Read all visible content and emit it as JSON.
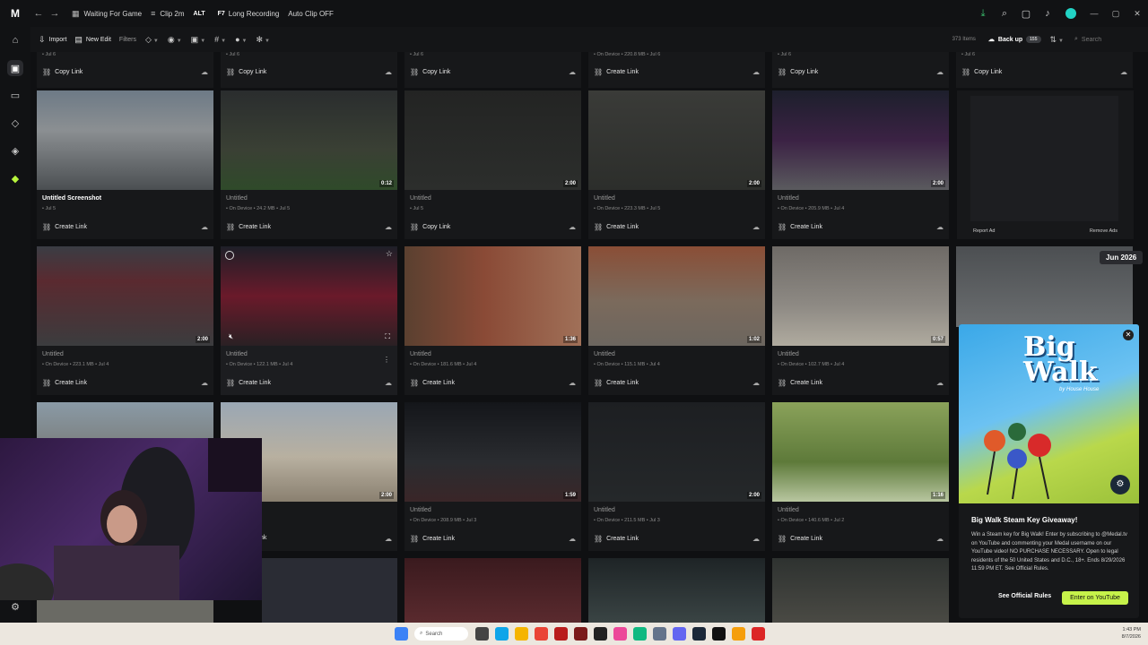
{
  "titlebar": {
    "tabs": [
      {
        "label": "Waiting For Game"
      },
      {
        "label": "Clip 2m"
      },
      {
        "key": "ALT",
        "label": ""
      },
      {
        "key": "F7",
        "label": "Long Recording"
      },
      {
        "label": "Auto Clip OFF"
      }
    ]
  },
  "toolbar": {
    "import": "Import",
    "new_edit": "New Edit",
    "filters": "Filters",
    "count": "373 Items",
    "backup": "Back up",
    "backup_badge": "155",
    "search_placeholder": "Search"
  },
  "top_row": [
    {
      "meta": "• Jul 6",
      "action": "Copy Link"
    },
    {
      "meta": "• Jul 6",
      "action": "Copy Link"
    },
    {
      "meta": "• Jul 6",
      "action": "Copy Link"
    },
    {
      "meta": "• On Device • 220.8 MB • Jul 6",
      "action": "Create Link"
    },
    {
      "meta": "• Jul 6",
      "action": "Copy Link"
    },
    {
      "meta": "• Jul 6",
      "action": "Copy Link"
    }
  ],
  "row1": [
    {
      "title": "Untitled Screenshot",
      "meta": "• Jul 5",
      "duration": "",
      "action": "Create Link",
      "bright": true
    },
    {
      "title": "Untitled",
      "meta": "• On Device • 24.2 MB • Jul 5",
      "duration": "0:12",
      "action": "Create Link"
    },
    {
      "title": "Untitled",
      "meta": "• Jul 5",
      "duration": "2:00",
      "action": "Copy Link"
    },
    {
      "title": "Untitled",
      "meta": "• On Device • 223.3 MB • Jul 5",
      "duration": "2:00",
      "action": "Create Link"
    },
    {
      "title": "Untitled",
      "meta": "• On Device • 205.9 MB • Jul 4",
      "duration": "2:00",
      "action": "Create Link"
    }
  ],
  "row2": [
    {
      "title": "Untitled",
      "meta": "• On Device • 223.1 MB • Jul 4",
      "duration": "2:00",
      "action": "Create Link"
    },
    {
      "title": "Untitled",
      "meta": "• On Device • 122.1 MB • Jul 4",
      "duration": "",
      "action": "Create Link"
    },
    {
      "title": "Untitled",
      "meta": "• On Device • 181.6 MB • Jul 4",
      "duration": "1:36",
      "action": "Create Link"
    },
    {
      "title": "Untitled",
      "meta": "• On Device • 115.1 MB • Jul 4",
      "duration": "1:02",
      "action": "Create Link"
    },
    {
      "title": "Untitled",
      "meta": "• On Device • 102.7 MB • Jul 4",
      "duration": "0:57",
      "action": "Create Link"
    }
  ],
  "row3": [
    {
      "title": "",
      "meta": "",
      "duration": "",
      "action": ""
    },
    {
      "title": "",
      "meta": "",
      "duration": "2:00",
      "action": "nk"
    },
    {
      "title": "Untitled",
      "meta": "• On Device • 208.9 MB • Jul 3",
      "duration": "1:59",
      "action": "Create Link"
    },
    {
      "title": "Untitled",
      "meta": "• On Device • 211.5 MB • Jul 3",
      "duration": "2:00",
      "action": "Create Link"
    },
    {
      "title": "Untitled",
      "meta": "• On Device • 140.6 MB • Jul 2",
      "duration": "1:16",
      "action": "Create Link"
    }
  ],
  "ad_top": {
    "report": "Report Ad",
    "remove": "Remove Ads"
  },
  "month_badge": "Jun 2026",
  "ad": {
    "art_title_1": "Big",
    "art_title_2": "Walk",
    "art_byline": "by House House",
    "title": "Big Walk Steam Key Giveaway!",
    "body": "Win a Steam key for Big Walk! Enter by subscribing to @Medal.tv on YouTube and commenting your Medal username on our YouTube video! NO PURCHASE NECESSARY. Open to legal residents of the 50 United States and D.C., 18+. Ends 8/29/2026 11:59 PM ET. See Official Rules.",
    "rules_button": "See Official Rules",
    "cta_button": "Enter on YouTube"
  },
  "taskbar": {
    "search": "Search",
    "time": "1:43 PM",
    "date": "8/7/2026"
  },
  "colors": {
    "accent": "#b7f43c",
    "bg": "#0f1012",
    "card": "#17181a"
  }
}
